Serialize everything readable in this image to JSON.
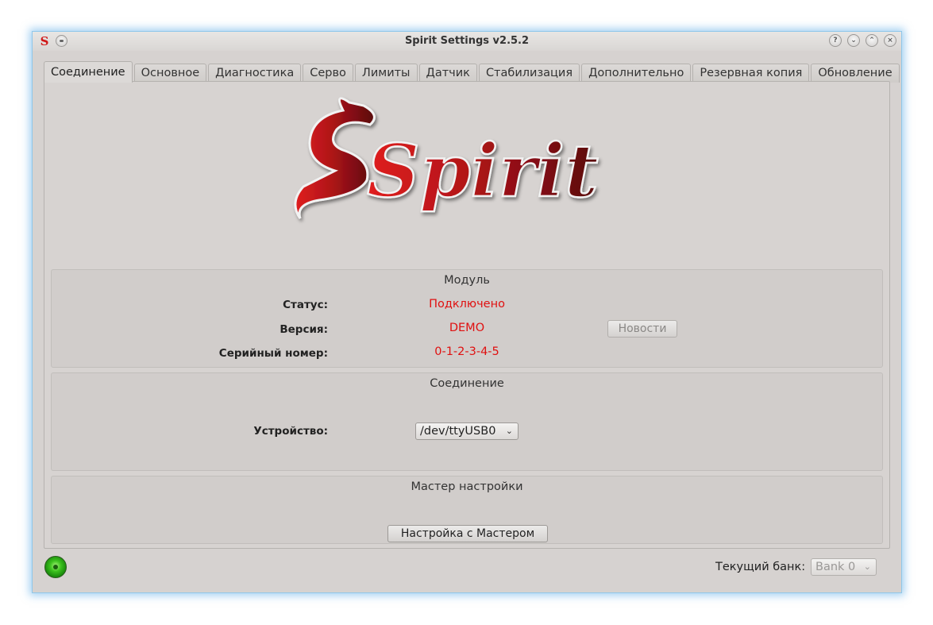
{
  "window": {
    "title": "Spirit Settings v2.5.2",
    "app_icon": "S",
    "buttons": {
      "help": "?",
      "minimize": "⌄",
      "maximize": "⌃",
      "close": "×"
    }
  },
  "tabs": [
    {
      "label": "Соединение",
      "active": true
    },
    {
      "label": "Основное"
    },
    {
      "label": "Диагностика"
    },
    {
      "label": "Серво"
    },
    {
      "label": "Лимиты"
    },
    {
      "label": "Датчик"
    },
    {
      "label": "Стабилизация"
    },
    {
      "label": "Дополнительно"
    },
    {
      "label": "Резервная копия"
    },
    {
      "label": "Обновление"
    }
  ],
  "logo": {
    "text": "Spirit"
  },
  "module": {
    "title": "Модуль",
    "status_label": "Статус:",
    "status_value": "Подключено",
    "version_label": "Версия:",
    "version_value": "DEMO",
    "serial_label": "Серийный номер:",
    "serial_value": "0-1-2-3-4-5",
    "news_button": "Новости"
  },
  "connection": {
    "title": "Соединение",
    "device_label": "Устройство:",
    "device_value": "/dev/ttyUSB0"
  },
  "wizard": {
    "title": "Мастер настройки",
    "button": "Настройка с Мастером"
  },
  "footer": {
    "bank_label": "Текущий банк:",
    "bank_value": "Bank 0"
  },
  "colors": {
    "accent_red": "#e01010",
    "window_border": "#8fc7ea",
    "status_led": "#3cc21e"
  }
}
